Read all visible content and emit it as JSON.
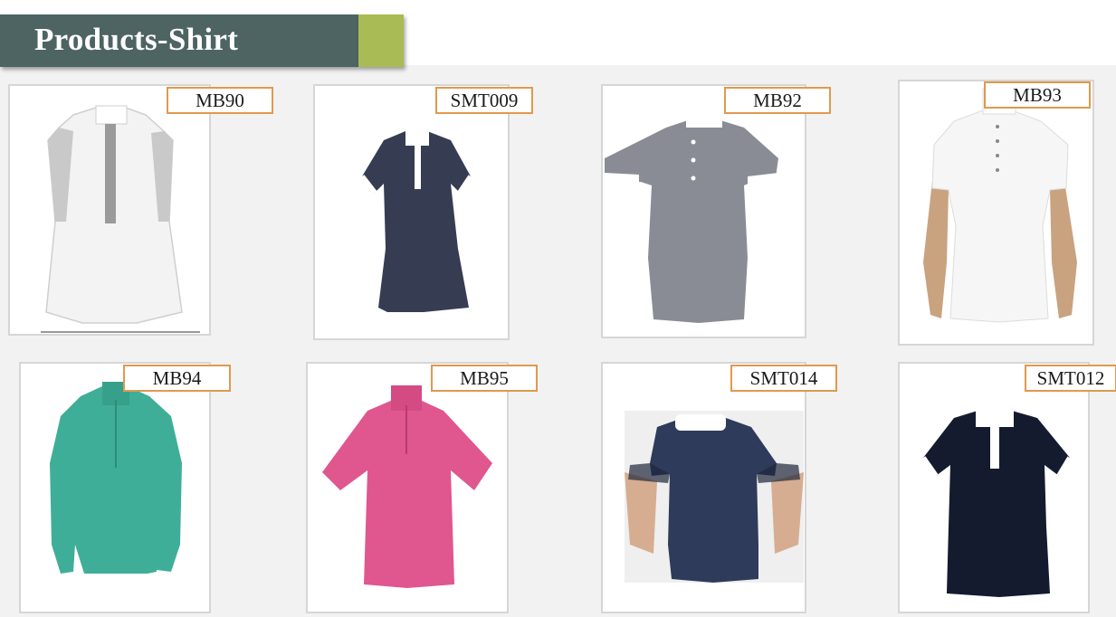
{
  "header": {
    "title": "Products-Shirt"
  },
  "products": [
    {
      "code": "MB90",
      "shirt_color": "#f3f3f3",
      "trim_color": "#9a9a9a"
    },
    {
      "code": "SMT009",
      "shirt_color": "#363d52",
      "trim_color": "#ffffff"
    },
    {
      "code": "MB92",
      "shirt_color": "#8a8c95",
      "trim_color": "#ffffff"
    },
    {
      "code": "MB93",
      "shirt_color": "#f6f6f6",
      "trim_color": "#e8e8e8"
    },
    {
      "code": "MB94",
      "shirt_color": "#3fae98",
      "trim_color": "#37a08b"
    },
    {
      "code": "MB95",
      "shirt_color": "#e0568f",
      "trim_color": "#d44a83"
    },
    {
      "code": "SMT014",
      "shirt_color": "#2e3b5a",
      "trim_color": "#ffffff"
    },
    {
      "code": "SMT012",
      "shirt_color": "#141b2e",
      "trim_color": "#ffffff"
    }
  ],
  "colors": {
    "header_bg": "#4d6462",
    "header_accent": "#a9bb55",
    "label_border": "#e0994e"
  }
}
